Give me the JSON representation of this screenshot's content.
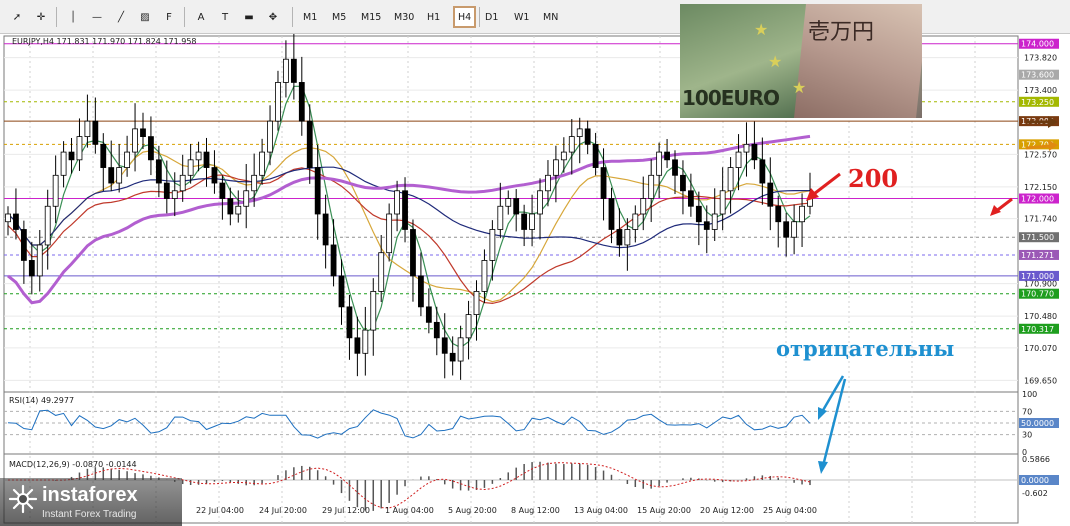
{
  "toolbar": {
    "tools": [
      {
        "name": "cursor-icon",
        "glyph": "➚"
      },
      {
        "name": "crosshair-icon",
        "glyph": "✛"
      },
      {
        "name": "vertical-line-icon",
        "glyph": "│"
      },
      {
        "name": "horizontal-line-icon",
        "glyph": "—"
      },
      {
        "name": "trendline-icon",
        "glyph": "╱"
      },
      {
        "name": "channel-icon",
        "glyph": "▨"
      },
      {
        "name": "fibonacci-icon",
        "glyph": "F"
      },
      {
        "name": "text-icon",
        "glyph": "A"
      },
      {
        "name": "text-label-icon",
        "glyph": "T"
      },
      {
        "name": "rectangle-icon",
        "glyph": "▬"
      },
      {
        "name": "shapes-icon",
        "glyph": "✥"
      }
    ],
    "timeframes": [
      "M1",
      "M5",
      "M15",
      "M30",
      "H1",
      "H4",
      "D1",
      "W1",
      "MN"
    ],
    "active_timeframe": "H4"
  },
  "main_panel": {
    "info": "EURJPY,H4  171.831 171.970 171.824 171.958",
    "price_ticks": [
      "173.820",
      "173.400",
      "172.570",
      "172.150",
      "171.740",
      "170.900",
      "170.480",
      "170.070",
      "169.650"
    ],
    "price_tags": [
      {
        "label": "174.000",
        "value": 174.0,
        "color": "#cc22cc"
      },
      {
        "label": "173.600",
        "value": 173.6,
        "color": "#a9a9a9"
      },
      {
        "label": "173.250",
        "value": 173.25,
        "color": "#a4b800"
      },
      {
        "label": "173.000",
        "value": 173.0,
        "color": "#7a3a10"
      },
      {
        "label": "172.700",
        "value": 172.7,
        "color": "#d8a000"
      },
      {
        "label": "172.000",
        "value": 172.0,
        "color": "#cc22cc"
      },
      {
        "label": "171.500",
        "value": 171.5,
        "color": "#707070"
      },
      {
        "label": "171.271",
        "value": 171.271,
        "color": "#9b59b6"
      },
      {
        "label": "171.000",
        "value": 171.0,
        "color": "#6a5acd"
      },
      {
        "label": "170.770",
        "value": 170.77,
        "color": "#1e9e1e"
      },
      {
        "label": "170.317",
        "value": 170.317,
        "color": "#1e9e1e"
      }
    ],
    "price_lines": [
      {
        "value": 174.0,
        "color": "#cc22cc",
        "dash": false
      },
      {
        "value": 173.25,
        "color": "#a4b800",
        "dash": true
      },
      {
        "value": 173.0,
        "color": "#8b4513",
        "dash": false
      },
      {
        "value": 172.7,
        "color": "#d8a000",
        "dash": true
      },
      {
        "value": 172.0,
        "color": "#cc22cc",
        "dash": false
      },
      {
        "value": 171.5,
        "color": "#909090",
        "dash": true
      },
      {
        "value": 171.271,
        "color": "#7b68ee",
        "dash": true
      },
      {
        "value": 171.0,
        "color": "#6a5acd",
        "dash": false
      },
      {
        "value": 170.77,
        "color": "#1e9e1e",
        "dash": true
      },
      {
        "value": 170.317,
        "color": "#1e9e1e",
        "dash": true
      }
    ]
  },
  "rsi_panel": {
    "label": "RSI(14) 49.2977",
    "ticks": [
      "100",
      "70",
      "30",
      "0"
    ],
    "tag": "50.0000"
  },
  "macd_panel": {
    "label": "MACD(12,26,9) -0.0870 -0.0144",
    "ticks": [
      "0.5866",
      "-0.602"
    ],
    "tag": "0.0000"
  },
  "time_axis": [
    "22 Jul 04:00",
    "24 Jul 20:00",
    "29 Jul 12:00",
    "1 Aug 04:00",
    "5 Aug 20:00",
    "8 Aug 12:00",
    "13 Aug 04:00",
    "15 Aug 20:00",
    "20 Aug 12:00",
    "25 Aug 04:00"
  ],
  "annotations": {
    "level_200": "200",
    "negative": "отрицательны"
  },
  "photo": {
    "euro_text": "100EURO",
    "yen_text": "壱万円"
  },
  "logo": {
    "name": "instaforex",
    "tagline": "Instant Forex Trading"
  },
  "chart_data": {
    "type": "candlestick",
    "symbol": "EURJPY",
    "timeframe": "H4",
    "ohlc_last": {
      "open": 171.831,
      "high": 171.97,
      "low": 171.824,
      "close": 171.958
    },
    "ylim": [
      169.5,
      174.1
    ],
    "closes": [
      171.8,
      171.6,
      171.2,
      171.0,
      171.4,
      171.9,
      172.3,
      172.6,
      172.5,
      172.8,
      173.0,
      172.7,
      172.4,
      172.2,
      172.4,
      172.6,
      172.9,
      172.8,
      172.5,
      172.2,
      172.0,
      172.1,
      172.3,
      172.5,
      172.6,
      172.4,
      172.2,
      172.0,
      171.8,
      171.9,
      172.1,
      172.3,
      172.6,
      173.0,
      173.5,
      173.8,
      173.5,
      173.0,
      172.4,
      171.8,
      171.4,
      171.0,
      170.6,
      170.2,
      170.0,
      170.3,
      170.8,
      171.3,
      171.8,
      172.1,
      171.6,
      171.0,
      170.6,
      170.4,
      170.2,
      170.0,
      169.9,
      170.2,
      170.5,
      170.8,
      171.2,
      171.6,
      171.9,
      172.0,
      171.8,
      171.6,
      171.8,
      172.1,
      172.3,
      172.5,
      172.6,
      172.8,
      172.9,
      172.7,
      172.4,
      172.0,
      171.6,
      171.4,
      171.6,
      171.8,
      172.0,
      172.3,
      172.6,
      172.5,
      172.3,
      172.1,
      171.9,
      171.7,
      171.6,
      171.8,
      172.1,
      172.4,
      172.6,
      172.7,
      172.5,
      172.2,
      171.9,
      171.7,
      171.5,
      171.7,
      171.9,
      172.0
    ],
    "moving_averages": [
      {
        "period": "fast",
        "color": "#3a8f55"
      },
      {
        "period": "medium",
        "color": "#d7a73a"
      },
      {
        "period": "slow",
        "color": "#c0392b"
      },
      {
        "period": "slower",
        "color": "#1f2a7a"
      },
      {
        "period": "200",
        "color": "#b25fd0"
      }
    ],
    "x_labels": [
      "22 Jul 04:00",
      "24 Jul 20:00",
      "29 Jul 12:00",
      "1 Aug 04:00",
      "5 Aug 20:00",
      "8 Aug 12:00",
      "13 Aug 04:00",
      "15 Aug 20:00",
      "20 Aug 12:00",
      "25 Aug 04:00"
    ],
    "rsi_last": 49.2977,
    "rsi_levels": [
      30,
      50,
      70
    ],
    "macd": {
      "main": -0.087,
      "signal": -0.0144
    }
  }
}
